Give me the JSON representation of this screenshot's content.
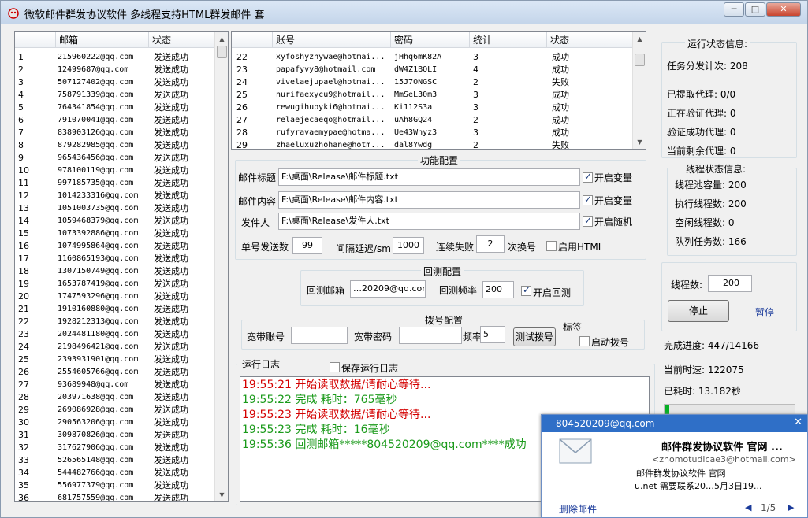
{
  "window": {
    "title": "微软邮件群发协议软件 多线程支持HTML群发邮件 套",
    "min": "─",
    "max": "□",
    "close": "✕"
  },
  "left_table": {
    "headers": [
      "邮箱",
      "状态"
    ],
    "rows": [
      [
        "1",
        "215960222@qq.com",
        "发送成功"
      ],
      [
        "2",
        "12499687@qq.com",
        "发送成功"
      ],
      [
        "3",
        "507127402@qq.com",
        "发送成功"
      ],
      [
        "4",
        "758791339@qq.com",
        "发送成功"
      ],
      [
        "5",
        "764341854@qq.com",
        "发送成功"
      ],
      [
        "6",
        "791070041@qq.com",
        "发送成功"
      ],
      [
        "7",
        "838903126@qq.com",
        "发送成功"
      ],
      [
        "8",
        "879282985@qq.com",
        "发送成功"
      ],
      [
        "9",
        "965436456@qq.com",
        "发送成功"
      ],
      [
        "10",
        "978100119@qq.com",
        "发送成功"
      ],
      [
        "11",
        "997185735@qq.com",
        "发送成功"
      ],
      [
        "12",
        "1014233316@qq.com",
        "发送成功"
      ],
      [
        "13",
        "1051003735@qq.com",
        "发送成功"
      ],
      [
        "14",
        "1059468379@qq.com",
        "发送成功"
      ],
      [
        "15",
        "1073392886@qq.com",
        "发送成功"
      ],
      [
        "16",
        "1074995864@qq.com",
        "发送成功"
      ],
      [
        "17",
        "1160865193@qq.com",
        "发送成功"
      ],
      [
        "18",
        "1307150749@qq.com",
        "发送成功"
      ],
      [
        "19",
        "1653787419@qq.com",
        "发送成功"
      ],
      [
        "20",
        "1747593296@qq.com",
        "发送成功"
      ],
      [
        "21",
        "1910160880@qq.com",
        "发送成功"
      ],
      [
        "22",
        "1928212313@qq.com",
        "发送成功"
      ],
      [
        "23",
        "2024481180@qq.com",
        "发送成功"
      ],
      [
        "24",
        "2198496421@qq.com",
        "发送成功"
      ],
      [
        "25",
        "2393931901@qq.com",
        "发送成功"
      ],
      [
        "26",
        "2554605766@qq.com",
        "发送成功"
      ],
      [
        "27",
        "93689948@qq.com",
        "发送成功"
      ],
      [
        "28",
        "203971638@qq.com",
        "发送成功"
      ],
      [
        "29",
        "269086928@qq.com",
        "发送成功"
      ],
      [
        "30",
        "290563206@qq.com",
        "发送成功"
      ],
      [
        "31",
        "309870826@qq.com",
        "发送成功"
      ],
      [
        "32",
        "317627906@qq.com",
        "发送成功"
      ],
      [
        "33",
        "526565148@qq.com",
        "发送成功"
      ],
      [
        "34",
        "544482766@qq.com",
        "发送成功"
      ],
      [
        "35",
        "556977379@qq.com",
        "发送成功"
      ],
      [
        "36",
        "681757559@qq.com",
        "发送成功"
      ]
    ]
  },
  "account_table": {
    "headers": [
      "账号",
      "密码",
      "统计",
      "状态"
    ],
    "rows": [
      [
        "22",
        "xyfoshyzhywae@hotmai...",
        "jHhq6mK82A",
        "3",
        "成功"
      ],
      [
        "23",
        "papafyvy8@hotmail.com",
        "dW4Z1BQLI",
        "4",
        "成功"
      ],
      [
        "24",
        "vivelaejupael@hotmai...",
        "15J7ONGSC",
        "2",
        "失败"
      ],
      [
        "25",
        "nurifaexycu9@hotmail...",
        "MmSeL30m3",
        "3",
        "成功"
      ],
      [
        "26",
        "rewugihupyki6@hotmai...",
        "Ki112S3a",
        "3",
        "成功"
      ],
      [
        "27",
        "relaejecaeqo@hotmail...",
        "uAh8GQ24",
        "2",
        "成功"
      ],
      [
        "28",
        "rufyravaemypae@hotma...",
        "Ue43Wnyz3",
        "3",
        "成功"
      ],
      [
        "29",
        "zhaeluxuzhohane@hotm...",
        "dal8Ywdg",
        "2",
        "失败"
      ]
    ]
  },
  "func_config": {
    "title": "功能配置",
    "subject_label": "邮件标题",
    "subject_path": "F:\\桌面\\Release\\邮件标题.txt",
    "subject_cb": "开启变量",
    "content_label": "邮件内容",
    "content_path": "F:\\桌面\\Release\\邮件内容.txt",
    "content_cb": "开启变量",
    "sender_label": "发件人",
    "sender_path": "F:\\桌面\\Release\\发件人.txt",
    "sender_cb": "开启随机",
    "single_label": "单号发送数",
    "single_value": "99",
    "interval_label": "间隔延迟/sm",
    "interval_value": "1000",
    "fail_label": "连续失败",
    "fail_value": "2",
    "switch_label": "次换号",
    "html_label": "启用HTML"
  },
  "check_config": {
    "title": "回测配置",
    "mail_label": "回测邮箱",
    "mail_value": "…20209@qq.com",
    "freq_label": "回测频率",
    "freq_value": "200",
    "enable_label": "开启回测"
  },
  "dial_config": {
    "title": "拨号配置",
    "account_label": "宽带账号",
    "password_label": "宽带密码",
    "freq_label": "频率",
    "freq_value": "5",
    "test_button": "测试拨号",
    "tag_label": "标签",
    "enable_label": "启动拨号"
  },
  "log": {
    "title": "运行日志",
    "save_label": "保存运行日志",
    "lines": [
      {
        "text": "19:55:21 开始读取数据/请耐心等待...",
        "color": "#d40000"
      },
      {
        "text": "19:55:22 完成 耗时：765毫秒",
        "color": "#1a9a1a"
      },
      {
        "text": "19:55:23 开始读取数据/请耐心等待...",
        "color": "#d40000"
      },
      {
        "text": "19:55:23 完成 耗时：16毫秒",
        "color": "#1a9a1a"
      },
      {
        "text": "19:55:36 回测邮箱*****804520209@qq.com****成功",
        "color": "#1a9a1a"
      }
    ]
  },
  "run_status": {
    "title": "运行状态信息:",
    "lines": [
      "任务分发计次: 208",
      "已提取代理: 0/0",
      "正在验证代理: 0",
      "验证成功代理: 0",
      "当前剩余代理: 0"
    ]
  },
  "thread_status": {
    "title": "线程状态信息:",
    "lines": [
      "线程池容量: 200",
      "执行线程数: 200",
      "空闲线程数: 0",
      "队列任务数: 166"
    ]
  },
  "controls": {
    "threads_label": "线程数:",
    "threads_value": "200",
    "stop_button": "停止",
    "pause_link": "暂停",
    "progress": "完成进度: 447/14166",
    "speed": "当前时速: 122075",
    "elapsed": "已耗时: 13.182秒"
  },
  "popup": {
    "account": "804520209@qq.com",
    "subject": "邮件群发协议软件 官网 ...",
    "from": "<zhomotudicae3@hotmail.com>",
    "preview1": "邮件群发协议软件 官网",
    "preview2": "u.net 需要联系20…5月3日19...",
    "delete": "删除邮件",
    "pager": "1/5"
  },
  "colors": {
    "titlebar": "#c4d5ea",
    "log_red": "#d40000",
    "log_green": "#1a9a1a",
    "popup_header": "#2f6fc7",
    "link": "#1a3a9a"
  }
}
